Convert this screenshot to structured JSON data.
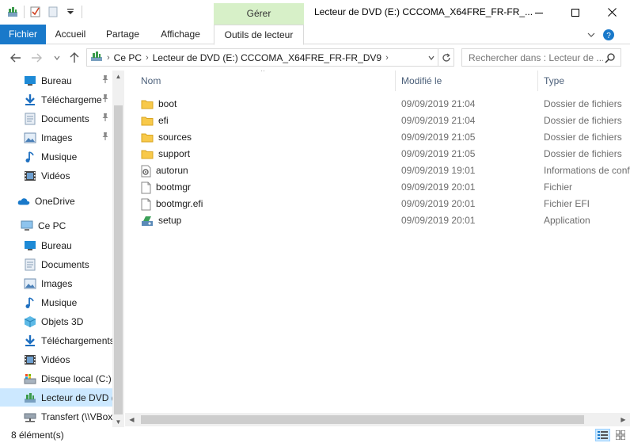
{
  "window": {
    "title": "Lecteur de DVD (E:) CCCOMA_X64FRE_FR-FR_...",
    "context_tab": "Gérer"
  },
  "ribbon": {
    "tabs": [
      "Fichier",
      "Accueil",
      "Partage",
      "Affichage",
      "Outils de lecteur"
    ]
  },
  "address": {
    "crumbs": [
      "Ce PC",
      "Lecteur de DVD (E:) CCCOMA_X64FRE_FR-FR_DV9"
    ],
    "search_placeholder": "Rechercher dans : Lecteur de ..."
  },
  "navpane": {
    "items": [
      {
        "label": "Bureau",
        "icon": "desktop-icon",
        "pinned": true
      },
      {
        "label": "Téléchargeme",
        "icon": "download-icon",
        "pinned": true
      },
      {
        "label": "Documents",
        "icon": "documents-icon",
        "pinned": true
      },
      {
        "label": "Images",
        "icon": "pictures-icon",
        "pinned": true
      },
      {
        "label": "Musique",
        "icon": "music-icon",
        "pinned": false
      },
      {
        "label": "Vidéos",
        "icon": "videos-icon",
        "pinned": false
      },
      {
        "label": "OneDrive",
        "icon": "onedrive-icon",
        "pinned": false
      },
      {
        "label": "Ce PC",
        "icon": "pc-icon",
        "pinned": false
      },
      {
        "label": "Bureau",
        "icon": "desktop-icon",
        "pinned": false
      },
      {
        "label": "Documents",
        "icon": "documents-icon",
        "pinned": false
      },
      {
        "label": "Images",
        "icon": "pictures-icon",
        "pinned": false
      },
      {
        "label": "Musique",
        "icon": "music-icon",
        "pinned": false
      },
      {
        "label": "Objets 3D",
        "icon": "3d-objects-icon",
        "pinned": false
      },
      {
        "label": "Téléchargements",
        "icon": "download-icon",
        "pinned": false
      },
      {
        "label": "Vidéos",
        "icon": "videos-icon",
        "pinned": false
      },
      {
        "label": "Disque local (C:)",
        "icon": "local-disk-icon",
        "pinned": false
      },
      {
        "label": "Lecteur de DVD (",
        "icon": "dvd-drive-icon",
        "pinned": false,
        "selected": true
      },
      {
        "label": "Transfert (\\\\VBox",
        "icon": "network-drive-icon",
        "pinned": false
      }
    ]
  },
  "filelist": {
    "columns": {
      "name": "Nom",
      "modified": "Modifié le",
      "type": "Type"
    },
    "rows": [
      {
        "name": "boot",
        "modified": "09/09/2019 21:04",
        "type": "Dossier de fichiers",
        "icon": "folder-icon"
      },
      {
        "name": "efi",
        "modified": "09/09/2019 21:04",
        "type": "Dossier de fichiers",
        "icon": "folder-icon"
      },
      {
        "name": "sources",
        "modified": "09/09/2019 21:05",
        "type": "Dossier de fichiers",
        "icon": "folder-icon"
      },
      {
        "name": "support",
        "modified": "09/09/2019 21:05",
        "type": "Dossier de fichiers",
        "icon": "folder-icon"
      },
      {
        "name": "autorun",
        "modified": "09/09/2019 19:01",
        "type": "Informations de conf",
        "icon": "settings-file-icon"
      },
      {
        "name": "bootmgr",
        "modified": "09/09/2019 20:01",
        "type": "Fichier",
        "icon": "file-icon"
      },
      {
        "name": "bootmgr.efi",
        "modified": "09/09/2019 20:01",
        "type": "Fichier EFI",
        "icon": "file-icon"
      },
      {
        "name": "setup",
        "modified": "09/09/2019 20:01",
        "type": "Application",
        "icon": "setup-icon"
      }
    ]
  },
  "status": {
    "count": "8 élément(s)"
  },
  "colors": {
    "accent": "#1979ca",
    "context_tab": "#d7f0c8",
    "selection": "#cce8ff",
    "folder": "#f8c94a"
  }
}
